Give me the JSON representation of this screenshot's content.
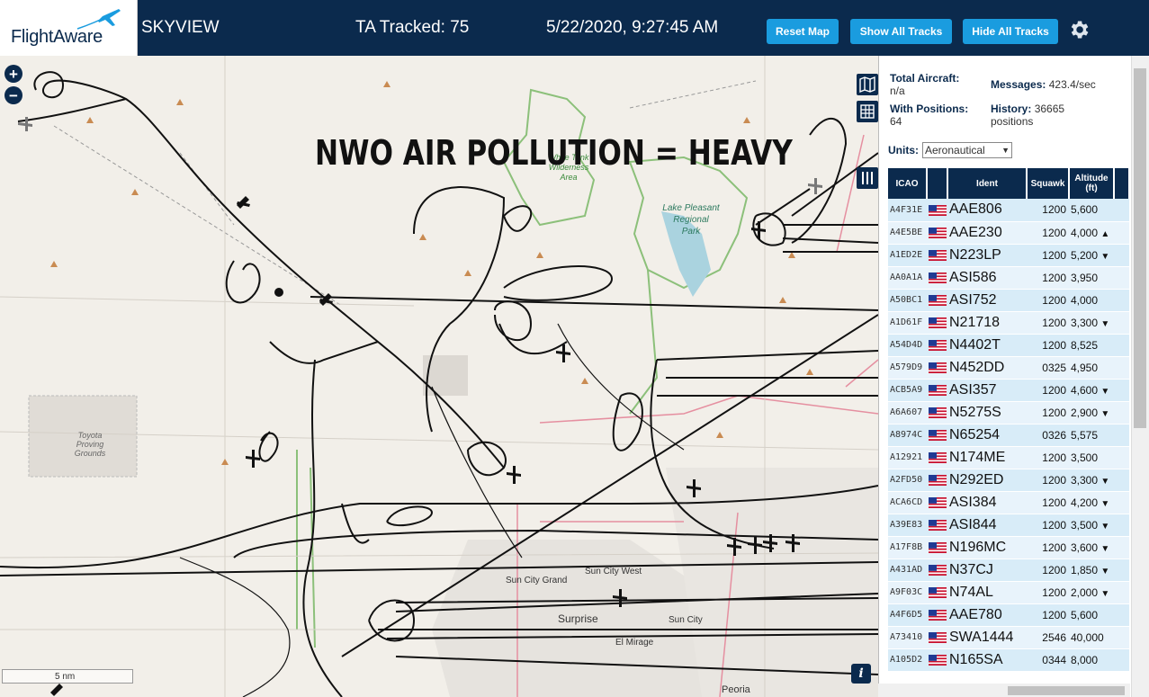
{
  "header": {
    "logo": "FlightAware",
    "app_name": "SKYVIEW",
    "tracked": "TA Tracked: 75",
    "datetime": "5/22/2020, 9:27:45 AM",
    "buttons": {
      "reset": "Reset Map",
      "show": "Show All Tracks",
      "hide": "Hide All Tracks"
    }
  },
  "map": {
    "overlay_title": "NWO AIR POLLUTION = HEAVY",
    "zoom_in": "+",
    "zoom_out": "−",
    "scale": "5 nm",
    "info": "i",
    "labels": {
      "wilderness": [
        "White Tank",
        "Wilderness",
        "Area"
      ],
      "lake": [
        "Lake Pleasant",
        "Regional",
        "Park"
      ],
      "toyota": [
        "Toyota",
        "Proving",
        "Grounds"
      ],
      "sun_city_west": "Sun City West",
      "sun_city_grand": "Sun City Grand",
      "surprise": "Surprise",
      "sun_city": "Sun City",
      "el_mirage": "El Mirage",
      "peoria": "Peoria"
    }
  },
  "panel": {
    "total_aircraft_label": "Total Aircraft:",
    "total_aircraft_value": "n/a",
    "messages_label": "Messages:",
    "messages_value": "423.4/sec",
    "with_positions_label": "With Positions:",
    "with_positions_value": "64",
    "history_label": "History:",
    "history_value": "36665",
    "history_unit": "positions",
    "units_label": "Units:",
    "units_value": "Aeronautical",
    "columns": {
      "icao": "ICAO",
      "ident": "Ident",
      "squawk": "Squawk",
      "alt1": "Altitude",
      "alt2": "(ft)"
    },
    "rows": [
      {
        "icao": "A4F31E",
        "ident": "AAE806",
        "squawk": "1200",
        "alt": "5,600",
        "trend": ""
      },
      {
        "icao": "A4E5BE",
        "ident": "AAE230",
        "squawk": "1200",
        "alt": "4,000",
        "trend": "▲"
      },
      {
        "icao": "A1ED2E",
        "ident": "N223LP",
        "squawk": "1200",
        "alt": "5,200",
        "trend": "▼"
      },
      {
        "icao": "AA0A1A",
        "ident": "ASI586",
        "squawk": "1200",
        "alt": "3,950",
        "trend": ""
      },
      {
        "icao": "A50BC1",
        "ident": "ASI752",
        "squawk": "1200",
        "alt": "4,000",
        "trend": ""
      },
      {
        "icao": "A1D61F",
        "ident": "N21718",
        "squawk": "1200",
        "alt": "3,300",
        "trend": "▼"
      },
      {
        "icao": "A54D4D",
        "ident": "N4402T",
        "squawk": "1200",
        "alt": "8,525",
        "trend": ""
      },
      {
        "icao": "A579D9",
        "ident": "N452DD",
        "squawk": "0325",
        "alt": "4,950",
        "trend": ""
      },
      {
        "icao": "ACB5A9",
        "ident": "ASI357",
        "squawk": "1200",
        "alt": "4,600",
        "trend": "▼"
      },
      {
        "icao": "A6A607",
        "ident": "N5275S",
        "squawk": "1200",
        "alt": "2,900",
        "trend": "▼"
      },
      {
        "icao": "A8974C",
        "ident": "N65254",
        "squawk": "0326",
        "alt": "5,575",
        "trend": ""
      },
      {
        "icao": "A12921",
        "ident": "N174ME",
        "squawk": "1200",
        "alt": "3,500",
        "trend": ""
      },
      {
        "icao": "A2FD50",
        "ident": "N292ED",
        "squawk": "1200",
        "alt": "3,300",
        "trend": "▼"
      },
      {
        "icao": "ACA6CD",
        "ident": "ASI384",
        "squawk": "1200",
        "alt": "4,200",
        "trend": "▼"
      },
      {
        "icao": "A39E83",
        "ident": "ASI844",
        "squawk": "1200",
        "alt": "3,500",
        "trend": "▼"
      },
      {
        "icao": "A17F8B",
        "ident": "N196MC",
        "squawk": "1200",
        "alt": "3,600",
        "trend": "▼"
      },
      {
        "icao": "A431AD",
        "ident": "N37CJ",
        "squawk": "1200",
        "alt": "1,850",
        "trend": "▼"
      },
      {
        "icao": "A9F03C",
        "ident": "N74AL",
        "squawk": "1200",
        "alt": "2,000",
        "trend": "▼"
      },
      {
        "icao": "A4F6D5",
        "ident": "AAE780",
        "squawk": "1200",
        "alt": "5,600",
        "trend": ""
      },
      {
        "icao": "A73410",
        "ident": "SWA1444",
        "squawk": "2546",
        "alt": "40,000",
        "trend": ""
      },
      {
        "icao": "A105D2",
        "ident": "N165SA",
        "squawk": "0344",
        "alt": "8,000",
        "trend": ""
      }
    ]
  },
  "colors": {
    "header_bg": "#0b2a4d",
    "button_bg": "#1a9cdf",
    "row_bg": "#d8ecf8"
  }
}
